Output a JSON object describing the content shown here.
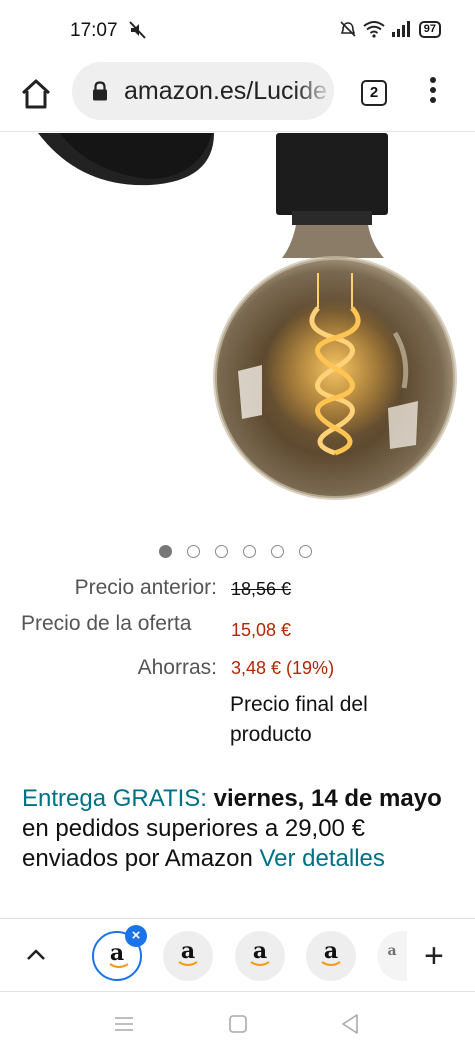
{
  "status_bar": {
    "time": "17:07",
    "battery": "97",
    "icons": [
      "mute-icon",
      "alarm-off-icon",
      "wifi-icon",
      "signal-icon",
      "battery-icon"
    ]
  },
  "browser": {
    "url": "amazon.es/Lucide",
    "tab_count": "2"
  },
  "carousel": {
    "total": 6,
    "active_index": 0
  },
  "pricing": {
    "previous_label": "Precio anterior:",
    "previous_value": "18,56 €",
    "deal_label": "Precio de la oferta",
    "deal_value": "15,08 €",
    "savings_label": "Ahorras:",
    "savings_value": "3,48 € (19%)",
    "final_note": "Precio final del producto"
  },
  "delivery": {
    "prefix": "Entrega GRATIS:",
    "date_bold": "viernes, 14 de mayo",
    "middle": " en pedidos superiores a 29,00 € enviados por Amazon ",
    "link": "Ver detalles"
  },
  "tab_strip": {
    "tabs": [
      {
        "label": "a",
        "active": true
      },
      {
        "label": "a",
        "active": false
      },
      {
        "label": "a",
        "active": false
      },
      {
        "label": "a",
        "active": false
      },
      {
        "label": "a",
        "active": false
      }
    ],
    "close_symbol": "×",
    "new_tab_symbol": "+"
  },
  "colors": {
    "accent_blue": "#1a73e8",
    "price_red": "#b12704",
    "link_teal": "#007185"
  }
}
